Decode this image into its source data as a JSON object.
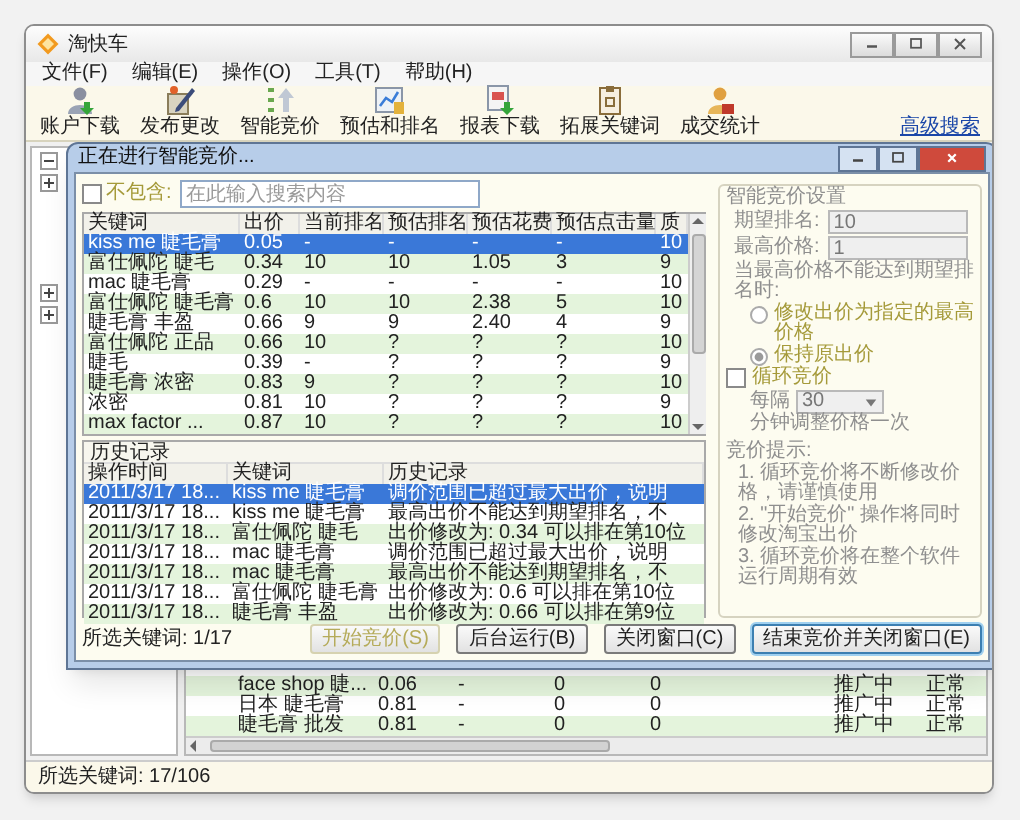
{
  "window": {
    "title": "淘快车"
  },
  "menu": [
    "文件(F)",
    "编辑(E)",
    "操作(O)",
    "工具(T)",
    "帮助(H)"
  ],
  "toolbar": [
    {
      "label": "账户下载"
    },
    {
      "label": "发布更改"
    },
    {
      "label": "智能竞价"
    },
    {
      "label": "预估和排名"
    },
    {
      "label": "报表下载"
    },
    {
      "label": "拓展关键词"
    },
    {
      "label": "成交统计"
    }
  ],
  "advanced_search": "高级搜索",
  "tree_toggles": [
    {
      "expanded": true
    },
    {
      "expanded": false
    },
    {
      "expanded": false
    },
    {
      "expanded": false
    }
  ],
  "list_rows": [
    {
      "cells": [
        "face shop 睫...",
        "0.06",
        "-",
        "0",
        "0",
        "推广中",
        "正常"
      ]
    },
    {
      "cells": [
        "日本 睫毛膏",
        "0.81",
        "-",
        "0",
        "0",
        "推广中",
        "正常"
      ]
    },
    {
      "cells": [
        "睫毛膏 批发",
        "0.81",
        "-",
        "0",
        "0",
        "推广中",
        "正常"
      ]
    }
  ],
  "status_bar": "所选关键词: 17/106",
  "dialog": {
    "title": "正在进行智能竞价...",
    "filter": {
      "label": "不包含:",
      "checked": false,
      "placeholder": "在此输入搜索内容"
    },
    "keywords": {
      "columns": [
        "关键词",
        "出价",
        "当前排名",
        "预估排名",
        "预估花费",
        "预估点击量",
        "质"
      ],
      "rows": [
        {
          "cells": [
            "kiss me 睫毛膏",
            "0.05",
            "-",
            "-",
            "-",
            "-",
            "10"
          ],
          "selected": true
        },
        {
          "cells": [
            "富仕佩陀 睫毛",
            "0.34",
            "10",
            "10",
            "1.05",
            "3",
            "9"
          ],
          "selected": false
        },
        {
          "cells": [
            "mac 睫毛膏",
            "0.29",
            "-",
            "-",
            "-",
            "-",
            "10"
          ],
          "selected": false
        },
        {
          "cells": [
            "富仕佩陀 睫毛膏",
            "0.6",
            "10",
            "10",
            "2.38",
            "5",
            "10"
          ],
          "selected": false
        },
        {
          "cells": [
            "睫毛膏 丰盈",
            "0.66",
            "9",
            "9",
            "2.40",
            "4",
            "9"
          ],
          "selected": false
        },
        {
          "cells": [
            "富仕佩陀 正品",
            "0.66",
            "10",
            "?",
            "?",
            "?",
            "10"
          ],
          "selected": false
        },
        {
          "cells": [
            "睫毛",
            "0.39",
            "-",
            "?",
            "?",
            "?",
            "9"
          ],
          "selected": false
        },
        {
          "cells": [
            "睫毛膏 浓密",
            "0.83",
            "9",
            "?",
            "?",
            "?",
            "10"
          ],
          "selected": false
        },
        {
          "cells": [
            "浓密",
            "0.81",
            "10",
            "?",
            "?",
            "?",
            "9"
          ],
          "selected": false
        },
        {
          "cells": [
            "max factor ...",
            "0.87",
            "10",
            "?",
            "?",
            "?",
            "10"
          ],
          "selected": false
        }
      ]
    },
    "history": {
      "title": "历史记录",
      "columns": [
        "操作时间",
        "关键词",
        "历史记录"
      ],
      "rows": [
        {
          "cells": [
            "2011/3/17 18...",
            "kiss me 睫毛膏",
            "调价范围已超过最大出价，说明"
          ],
          "selected": true
        },
        {
          "cells": [
            "2011/3/17 18...",
            "kiss me 睫毛膏",
            "最高出价不能达到期望排名，不"
          ],
          "selected": false
        },
        {
          "cells": [
            "2011/3/17 18...",
            "富仕佩陀 睫毛",
            "出价修改为: 0.34 可以排在第10位"
          ],
          "selected": false
        },
        {
          "cells": [
            "2011/3/17 18...",
            "mac 睫毛膏",
            "调价范围已超过最大出价，说明"
          ],
          "selected": false
        },
        {
          "cells": [
            "2011/3/17 18...",
            "mac 睫毛膏",
            "最高出价不能达到期望排名，不"
          ],
          "selected": false
        },
        {
          "cells": [
            "2011/3/17 18...",
            "富仕佩陀 睫毛膏",
            "出价修改为: 0.6 可以排在第10位"
          ],
          "selected": false
        },
        {
          "cells": [
            "2011/3/17 18...",
            "睫毛膏 丰盈",
            "出价修改为: 0.66 可以排在第9位"
          ],
          "selected": false
        }
      ]
    },
    "selection_count": "所选关键词: 1/17",
    "settings": {
      "title": "智能竞价设置",
      "disabled": true,
      "fields": [
        {
          "label": "期望排名:",
          "value": "10"
        },
        {
          "label": "最高价格:",
          "value": "1"
        }
      ],
      "fallback_label": "当最高价格不能达到期望排名时:",
      "options": [
        {
          "label": "修改出价为指定的最高价格",
          "selected": false
        },
        {
          "label": "保持原出价",
          "selected": true
        }
      ],
      "loop": {
        "label": "循环竞价",
        "checked": false
      },
      "interval": {
        "prefix": "每隔",
        "value": "30",
        "suffix": "分钟调整价格一次"
      },
      "tips_title": "竞价提示:",
      "tips": [
        "1. 循环竞价将不断修改价格，请谨慎使用",
        "2. \"开始竞价\" 操作将同时修改淘宝出价",
        "3. 循环竞价将在整个软件运行周期有效"
      ]
    },
    "buttons": [
      {
        "label": "开始竞价(S)",
        "disabled": true,
        "default": false
      },
      {
        "label": "后台运行(B)",
        "disabled": false,
        "default": false
      },
      {
        "label": "关闭窗口(C)",
        "disabled": false,
        "default": false
      },
      {
        "label": "结束竞价并关闭窗口(E)",
        "disabled": false,
        "default": true
      }
    ]
  }
}
